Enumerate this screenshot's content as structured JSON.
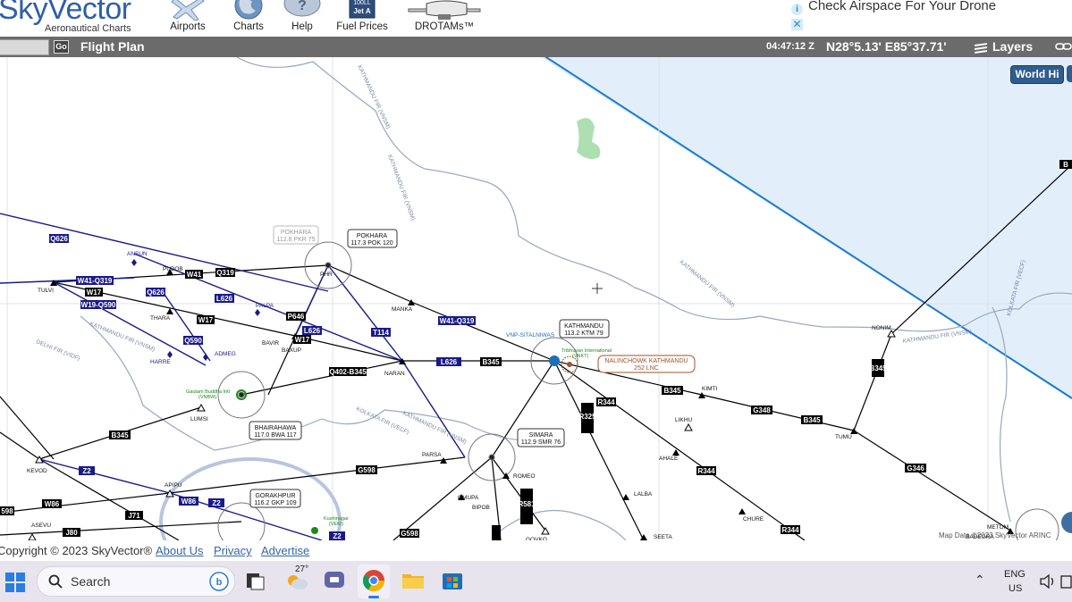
{
  "header": {
    "logo": "SkyVector",
    "logo_subtitle": "Aeronautical Charts",
    "nav": [
      {
        "label": "Airports",
        "icon": "airplane-icon"
      },
      {
        "label": "Charts",
        "icon": "globe-icon"
      },
      {
        "label": "Help",
        "icon": "question-bubble-icon"
      },
      {
        "label": "Fuel Prices",
        "icon": "fuel-sign-icon",
        "sign_text": "100LL Jet A"
      },
      {
        "label": "DROTAMs™",
        "icon": "drone-icon"
      }
    ],
    "ad": {
      "text": "Check Airspace For Your Drone",
      "info": "i",
      "close": "✕"
    }
  },
  "toolbar": {
    "go": "Go",
    "flight_plan": "Flight Plan",
    "time": "04:47:12 Z",
    "coordinates": "N28°5.13' E85°37.71'",
    "layers": "Layers"
  },
  "map": {
    "world_button": "World Hi",
    "map_data": "Map Data ©2023 SkyVector ARINC",
    "airspace_color": "#e3eefb",
    "boundary_color": "#1a7bd0",
    "vor_navaids": [
      {
        "name": "POKHARA",
        "detail": "117.3 POK 120"
      },
      {
        "name": "KATHMANDU",
        "detail": "113.2 KTM 79"
      },
      {
        "name": "SIMARA",
        "detail": "112.9 SMR 76"
      },
      {
        "name": "BHAIRAHAWA",
        "detail": "117.0 BWA 117"
      },
      {
        "name": "GORAKHPUR",
        "detail": "116.2 GKP 109"
      }
    ],
    "ndb_label": {
      "name": "NALINCHOWK KATHMANDU",
      "detail": "252 LNC"
    },
    "gray_label": {
      "name": "POKHARA",
      "detail": "112.8 PKR 75"
    },
    "fixes": [
      "ANSUN",
      "PUBOB",
      "TULVI",
      "THARA",
      "PALPA",
      "ADMEG",
      "HARRE",
      "BAVIR",
      "BAXUP",
      "NARAN",
      "MANKA",
      "VNP-SITALNIWAS",
      "LUMSI",
      "KEVOD",
      "APIPU",
      "PARSA",
      "OMUPA",
      "ROMEO",
      "BIPOB",
      "ASEVU",
      "KIMTI",
      "LIKHU",
      "AHALE",
      "LALBA",
      "CHURE",
      "SEETA",
      "TUMU",
      "NONIM",
      "GOVKO",
      "BADEGRA",
      "METOM",
      "PHR"
    ],
    "airways": [
      "W41-Q319",
      "W41",
      "Q319",
      "W17",
      "W19-Q590",
      "L626",
      "Q590",
      "Q626",
      "W17",
      "Q402-B345",
      "L626",
      "B345",
      "T114",
      "P646",
      "Q590",
      "B345",
      "W41-Q319",
      "Z2",
      "G598",
      "W86",
      "J71",
      "J80",
      "B345",
      "G348",
      "B345",
      "G346",
      "R344",
      "R344",
      "R344",
      "R344-G335",
      "R325",
      "B345",
      "R581-G463",
      "Z2",
      "W86",
      "J71",
      "G598",
      "G335",
      "G598"
    ],
    "airports": [
      {
        "name": "Tribhuvan International",
        "code": "(VNKT)"
      },
      {
        "name": "Gautam Buddha Intl",
        "code": "(VNBW)"
      },
      {
        "name": "Kushinagar",
        "code": "(VEKI)"
      }
    ],
    "fir_labels": [
      "KATHMANDU FIR (VNSM)",
      "DELHI FIR (VIDF)",
      "KATHMANDU FIR (VNSM)",
      "KOLKATA FIR (VECF)",
      "KATHMANDU FIR (VNSM)",
      "KATHMANDU FIR (VNSM)",
      "KOLKATA FIR (VECF)",
      "KATHMANDU FIR (VNSM)"
    ]
  },
  "footer": {
    "copyright": "Copyright © 2023 SkyVector®",
    "links": [
      "About Us",
      "Privacy",
      "Advertise"
    ]
  },
  "taskbar": {
    "search": "Search",
    "weather": "27°",
    "lang_line1": "ENG",
    "lang_line2": "US"
  }
}
